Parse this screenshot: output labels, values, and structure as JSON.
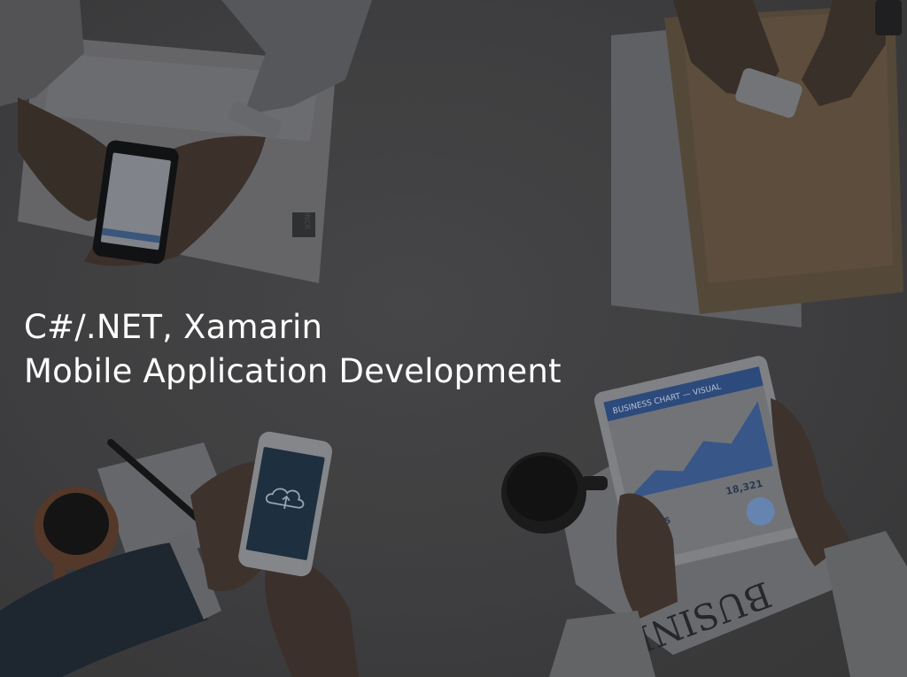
{
  "slide": {
    "title_line1": "C#/.NET, Xamarin",
    "title_line2": "Mobile Application Development"
  },
  "background": {
    "description_icons": [
      "smartphone-icon",
      "tablet-icon",
      "coffee-cup-icon",
      "pen-icon",
      "folder-icon",
      "newspaper-icon",
      "cloud-upload-icon"
    ],
    "tablet_heading": "BUSINESS CHART — VISUAL",
    "tablet_stat": "18,321",
    "tablet_stat2": "1,195",
    "newspaper_word": "BUSINESS",
    "sheet_label": "INCR"
  },
  "colors": {
    "background": "#414143",
    "title": "#ffffff"
  }
}
